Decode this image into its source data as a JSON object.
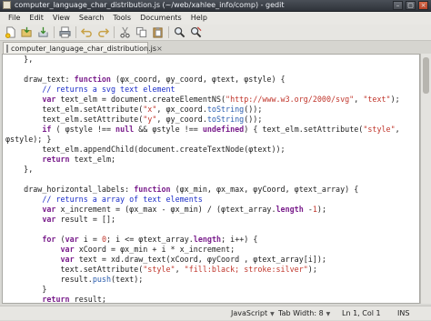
{
  "window": {
    "title": "computer_language_char_distribution.js (~/web/xahlee_info/comp) - gedit"
  },
  "menu": [
    "File",
    "Edit",
    "View",
    "Search",
    "Tools",
    "Documents",
    "Help"
  ],
  "tab": {
    "label": "computer_language_char_distribution.js",
    "close": "×"
  },
  "code_lines": [
    [
      {
        "t": "    },"
      }
    ],
    [
      {
        "t": ""
      }
    ],
    [
      {
        "t": "    draw_text: "
      },
      {
        "t": "function",
        "c": "kw"
      },
      {
        "t": " (φx_coord, φy_coord, φtext, φstyle) {"
      }
    ],
    [
      {
        "t": "        "
      },
      {
        "t": "// returns a svg text element",
        "c": "cm"
      }
    ],
    [
      {
        "t": "        "
      },
      {
        "t": "var",
        "c": "kw"
      },
      {
        "t": " text_elm = document.createElementNS("
      },
      {
        "t": "\"http://www.w3.org/2000/svg\"",
        "c": "str"
      },
      {
        "t": ", "
      },
      {
        "t": "\"text\"",
        "c": "str"
      },
      {
        "t": ");"
      }
    ],
    [
      {
        "t": "        text_elm.setAttribute("
      },
      {
        "t": "\"x\"",
        "c": "str"
      },
      {
        "t": ", φx_coord."
      },
      {
        "t": "toString",
        "c": "fn"
      },
      {
        "t": "());"
      }
    ],
    [
      {
        "t": "        text_elm.setAttribute("
      },
      {
        "t": "\"y\"",
        "c": "str"
      },
      {
        "t": ", φy_coord."
      },
      {
        "t": "toString",
        "c": "fn"
      },
      {
        "t": "());"
      }
    ],
    [
      {
        "t": "        "
      },
      {
        "t": "if",
        "c": "kw"
      },
      {
        "t": " ( φstyle !== "
      },
      {
        "t": "null",
        "c": "kw"
      },
      {
        "t": " && φstyle !== "
      },
      {
        "t": "undefined",
        "c": "kw"
      },
      {
        "t": ") { text_elm.setAttribute("
      },
      {
        "t": "\"style\"",
        "c": "str"
      },
      {
        "t": ","
      }
    ],
    [
      {
        "t": "φstyle); }"
      }
    ],
    [
      {
        "t": "        text_elm.appendChild(document.createTextNode(φtext));"
      }
    ],
    [
      {
        "t": "        "
      },
      {
        "t": "return",
        "c": "kw"
      },
      {
        "t": " text_elm;"
      }
    ],
    [
      {
        "t": "    },"
      }
    ],
    [
      {
        "t": ""
      }
    ],
    [
      {
        "t": "    draw_horizontal_labels: "
      },
      {
        "t": "function",
        "c": "kw"
      },
      {
        "t": " (φx_min, φx_max, φyCoord, φtext_array) {"
      }
    ],
    [
      {
        "t": "        "
      },
      {
        "t": "// returns a array of text elements",
        "c": "cm"
      }
    ],
    [
      {
        "t": "        "
      },
      {
        "t": "var",
        "c": "kw"
      },
      {
        "t": " x_increment = (φx_max - φx_min) / (φtext_array."
      },
      {
        "t": "length",
        "c": "kw"
      },
      {
        "t": " -"
      },
      {
        "t": "1",
        "c": "num"
      },
      {
        "t": ");"
      }
    ],
    [
      {
        "t": "        "
      },
      {
        "t": "var",
        "c": "kw"
      },
      {
        "t": " result = [];"
      }
    ],
    [
      {
        "t": ""
      }
    ],
    [
      {
        "t": "        "
      },
      {
        "t": "for",
        "c": "kw"
      },
      {
        "t": " ("
      },
      {
        "t": "var",
        "c": "kw"
      },
      {
        "t": " i = "
      },
      {
        "t": "0",
        "c": "num"
      },
      {
        "t": "; i <= φtext_array."
      },
      {
        "t": "length",
        "c": "kw"
      },
      {
        "t": "; i++) {"
      }
    ],
    [
      {
        "t": "            "
      },
      {
        "t": "var",
        "c": "kw"
      },
      {
        "t": " xCoord = φx_min + i * x_increment;"
      }
    ],
    [
      {
        "t": "            "
      },
      {
        "t": "var",
        "c": "kw"
      },
      {
        "t": " text = xd.draw_text(xCoord, φyCoord , φtext_array[i]);"
      }
    ],
    [
      {
        "t": "            text.setAttribute("
      },
      {
        "t": "\"style\"",
        "c": "str"
      },
      {
        "t": ", "
      },
      {
        "t": "\"fill:black; stroke:silver\"",
        "c": "str"
      },
      {
        "t": ");"
      }
    ],
    [
      {
        "t": "            result."
      },
      {
        "t": "push",
        "c": "fn"
      },
      {
        "t": "(text);"
      }
    ],
    [
      {
        "t": "        }"
      }
    ],
    [
      {
        "t": "        "
      },
      {
        "t": "return",
        "c": "kw"
      },
      {
        "t": " result;"
      }
    ],
    [
      {
        "t": "    },"
      }
    ]
  ],
  "status": {
    "language": "JavaScript",
    "tab_width": "Tab Width:  8",
    "position": "Ln 1, Col 1",
    "mode": "INS"
  },
  "colors": {
    "keyword": "#7a1e8c",
    "string": "#c0352b",
    "comment": "#1c2ec8",
    "method": "#2a5cae"
  },
  "toolbar_icons": [
    "new-document-icon",
    "open-icon",
    "save-icon",
    "print-icon",
    "undo-icon",
    "redo-icon",
    "cut-icon",
    "copy-icon",
    "paste-icon",
    "search-icon",
    "search-replace-icon"
  ]
}
